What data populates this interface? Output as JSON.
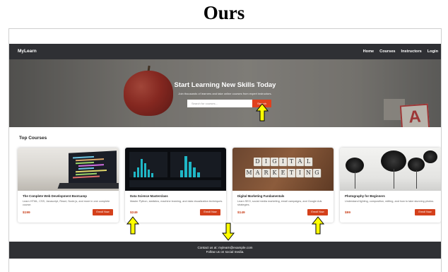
{
  "caption": "Ours",
  "navbar": {
    "brand": "MyLearn",
    "links": [
      "Home",
      "Courses",
      "Instructors",
      "Login"
    ]
  },
  "hero": {
    "title": "Start Learning New Skills Today",
    "subtitle": "Join thousands of learners and take online courses from expert instructors.",
    "search_placeholder": "Search for courses...",
    "search_button": "Search",
    "block_letter": "A"
  },
  "section_title": "Top Courses",
  "courses": [
    {
      "title": "The Complete Web Development Bootcamp",
      "description": "Learn HTML, CSS, Javascript, React, Node.js, and more in one complete course.",
      "price": "$199",
      "button": "Enroll Now"
    },
    {
      "title": "Data Science Masterclass",
      "description": "Master Python, statistics, machine learning, and data visualization techniques.",
      "price": "$249",
      "button": "Enroll Now"
    },
    {
      "title": "Digital Marketing Fundamentals",
      "description": "Learn SEO, social media marketing, email campaigns, and Google Ads strategies.",
      "price": "$149",
      "button": "Enroll Now"
    },
    {
      "title": "Photography for Beginners",
      "description": "Understand lighting, composition, editing, and how to take stunning photos.",
      "price": "$99",
      "button": "Enroll Now"
    }
  ],
  "tiles": {
    "row1": [
      "D",
      "I",
      "G",
      "I",
      "T",
      "A",
      "L"
    ],
    "row2": [
      "M",
      "A",
      "R",
      "K",
      "E",
      "T",
      "I",
      "N",
      "G"
    ]
  },
  "footer": {
    "contact": "Contact us at: mylearn@example.com",
    "social": "Follow us on social media."
  },
  "colors": {
    "accent": "#d4401b",
    "navbar": "#2f3034",
    "arrow": "#ffff00"
  }
}
